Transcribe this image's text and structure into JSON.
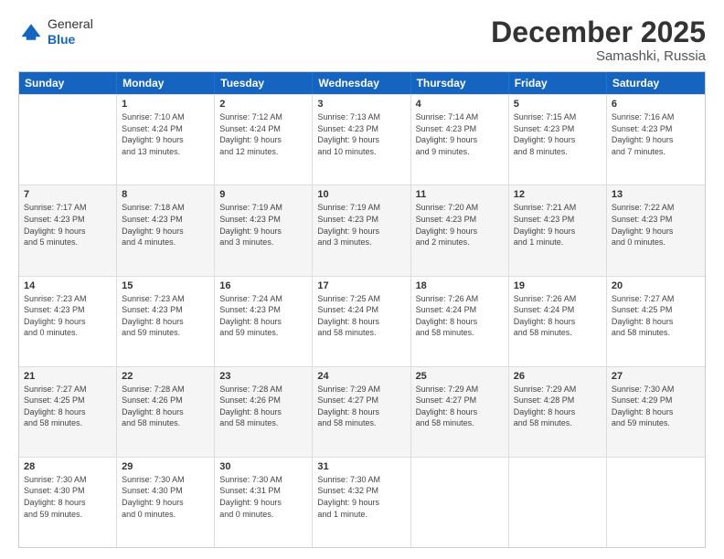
{
  "logo": {
    "general": "General",
    "blue": "Blue"
  },
  "header": {
    "month_title": "December 2025",
    "location": "Samashki, Russia"
  },
  "weekdays": [
    "Sunday",
    "Monday",
    "Tuesday",
    "Wednesday",
    "Thursday",
    "Friday",
    "Saturday"
  ],
  "weeks": [
    [
      {
        "day": "",
        "info": ""
      },
      {
        "day": "1",
        "info": "Sunrise: 7:10 AM\nSunset: 4:24 PM\nDaylight: 9 hours\nand 13 minutes."
      },
      {
        "day": "2",
        "info": "Sunrise: 7:12 AM\nSunset: 4:24 PM\nDaylight: 9 hours\nand 12 minutes."
      },
      {
        "day": "3",
        "info": "Sunrise: 7:13 AM\nSunset: 4:23 PM\nDaylight: 9 hours\nand 10 minutes."
      },
      {
        "day": "4",
        "info": "Sunrise: 7:14 AM\nSunset: 4:23 PM\nDaylight: 9 hours\nand 9 minutes."
      },
      {
        "day": "5",
        "info": "Sunrise: 7:15 AM\nSunset: 4:23 PM\nDaylight: 9 hours\nand 8 minutes."
      },
      {
        "day": "6",
        "info": "Sunrise: 7:16 AM\nSunset: 4:23 PM\nDaylight: 9 hours\nand 7 minutes."
      }
    ],
    [
      {
        "day": "7",
        "info": "Sunrise: 7:17 AM\nSunset: 4:23 PM\nDaylight: 9 hours\nand 5 minutes."
      },
      {
        "day": "8",
        "info": "Sunrise: 7:18 AM\nSunset: 4:23 PM\nDaylight: 9 hours\nand 4 minutes."
      },
      {
        "day": "9",
        "info": "Sunrise: 7:19 AM\nSunset: 4:23 PM\nDaylight: 9 hours\nand 3 minutes."
      },
      {
        "day": "10",
        "info": "Sunrise: 7:19 AM\nSunset: 4:23 PM\nDaylight: 9 hours\nand 3 minutes."
      },
      {
        "day": "11",
        "info": "Sunrise: 7:20 AM\nSunset: 4:23 PM\nDaylight: 9 hours\nand 2 minutes."
      },
      {
        "day": "12",
        "info": "Sunrise: 7:21 AM\nSunset: 4:23 PM\nDaylight: 9 hours\nand 1 minute."
      },
      {
        "day": "13",
        "info": "Sunrise: 7:22 AM\nSunset: 4:23 PM\nDaylight: 9 hours\nand 0 minutes."
      }
    ],
    [
      {
        "day": "14",
        "info": "Sunrise: 7:23 AM\nSunset: 4:23 PM\nDaylight: 9 hours\nand 0 minutes."
      },
      {
        "day": "15",
        "info": "Sunrise: 7:23 AM\nSunset: 4:23 PM\nDaylight: 8 hours\nand 59 minutes."
      },
      {
        "day": "16",
        "info": "Sunrise: 7:24 AM\nSunset: 4:23 PM\nDaylight: 8 hours\nand 59 minutes."
      },
      {
        "day": "17",
        "info": "Sunrise: 7:25 AM\nSunset: 4:24 PM\nDaylight: 8 hours\nand 58 minutes."
      },
      {
        "day": "18",
        "info": "Sunrise: 7:26 AM\nSunset: 4:24 PM\nDaylight: 8 hours\nand 58 minutes."
      },
      {
        "day": "19",
        "info": "Sunrise: 7:26 AM\nSunset: 4:24 PM\nDaylight: 8 hours\nand 58 minutes."
      },
      {
        "day": "20",
        "info": "Sunrise: 7:27 AM\nSunset: 4:25 PM\nDaylight: 8 hours\nand 58 minutes."
      }
    ],
    [
      {
        "day": "21",
        "info": "Sunrise: 7:27 AM\nSunset: 4:25 PM\nDaylight: 8 hours\nand 58 minutes."
      },
      {
        "day": "22",
        "info": "Sunrise: 7:28 AM\nSunset: 4:26 PM\nDaylight: 8 hours\nand 58 minutes."
      },
      {
        "day": "23",
        "info": "Sunrise: 7:28 AM\nSunset: 4:26 PM\nDaylight: 8 hours\nand 58 minutes."
      },
      {
        "day": "24",
        "info": "Sunrise: 7:29 AM\nSunset: 4:27 PM\nDaylight: 8 hours\nand 58 minutes."
      },
      {
        "day": "25",
        "info": "Sunrise: 7:29 AM\nSunset: 4:27 PM\nDaylight: 8 hours\nand 58 minutes."
      },
      {
        "day": "26",
        "info": "Sunrise: 7:29 AM\nSunset: 4:28 PM\nDaylight: 8 hours\nand 58 minutes."
      },
      {
        "day": "27",
        "info": "Sunrise: 7:30 AM\nSunset: 4:29 PM\nDaylight: 8 hours\nand 59 minutes."
      }
    ],
    [
      {
        "day": "28",
        "info": "Sunrise: 7:30 AM\nSunset: 4:30 PM\nDaylight: 8 hours\nand 59 minutes."
      },
      {
        "day": "29",
        "info": "Sunrise: 7:30 AM\nSunset: 4:30 PM\nDaylight: 9 hours\nand 0 minutes."
      },
      {
        "day": "30",
        "info": "Sunrise: 7:30 AM\nSunset: 4:31 PM\nDaylight: 9 hours\nand 0 minutes."
      },
      {
        "day": "31",
        "info": "Sunrise: 7:30 AM\nSunset: 4:32 PM\nDaylight: 9 hours\nand 1 minute."
      },
      {
        "day": "",
        "info": ""
      },
      {
        "day": "",
        "info": ""
      },
      {
        "day": "",
        "info": ""
      }
    ]
  ]
}
